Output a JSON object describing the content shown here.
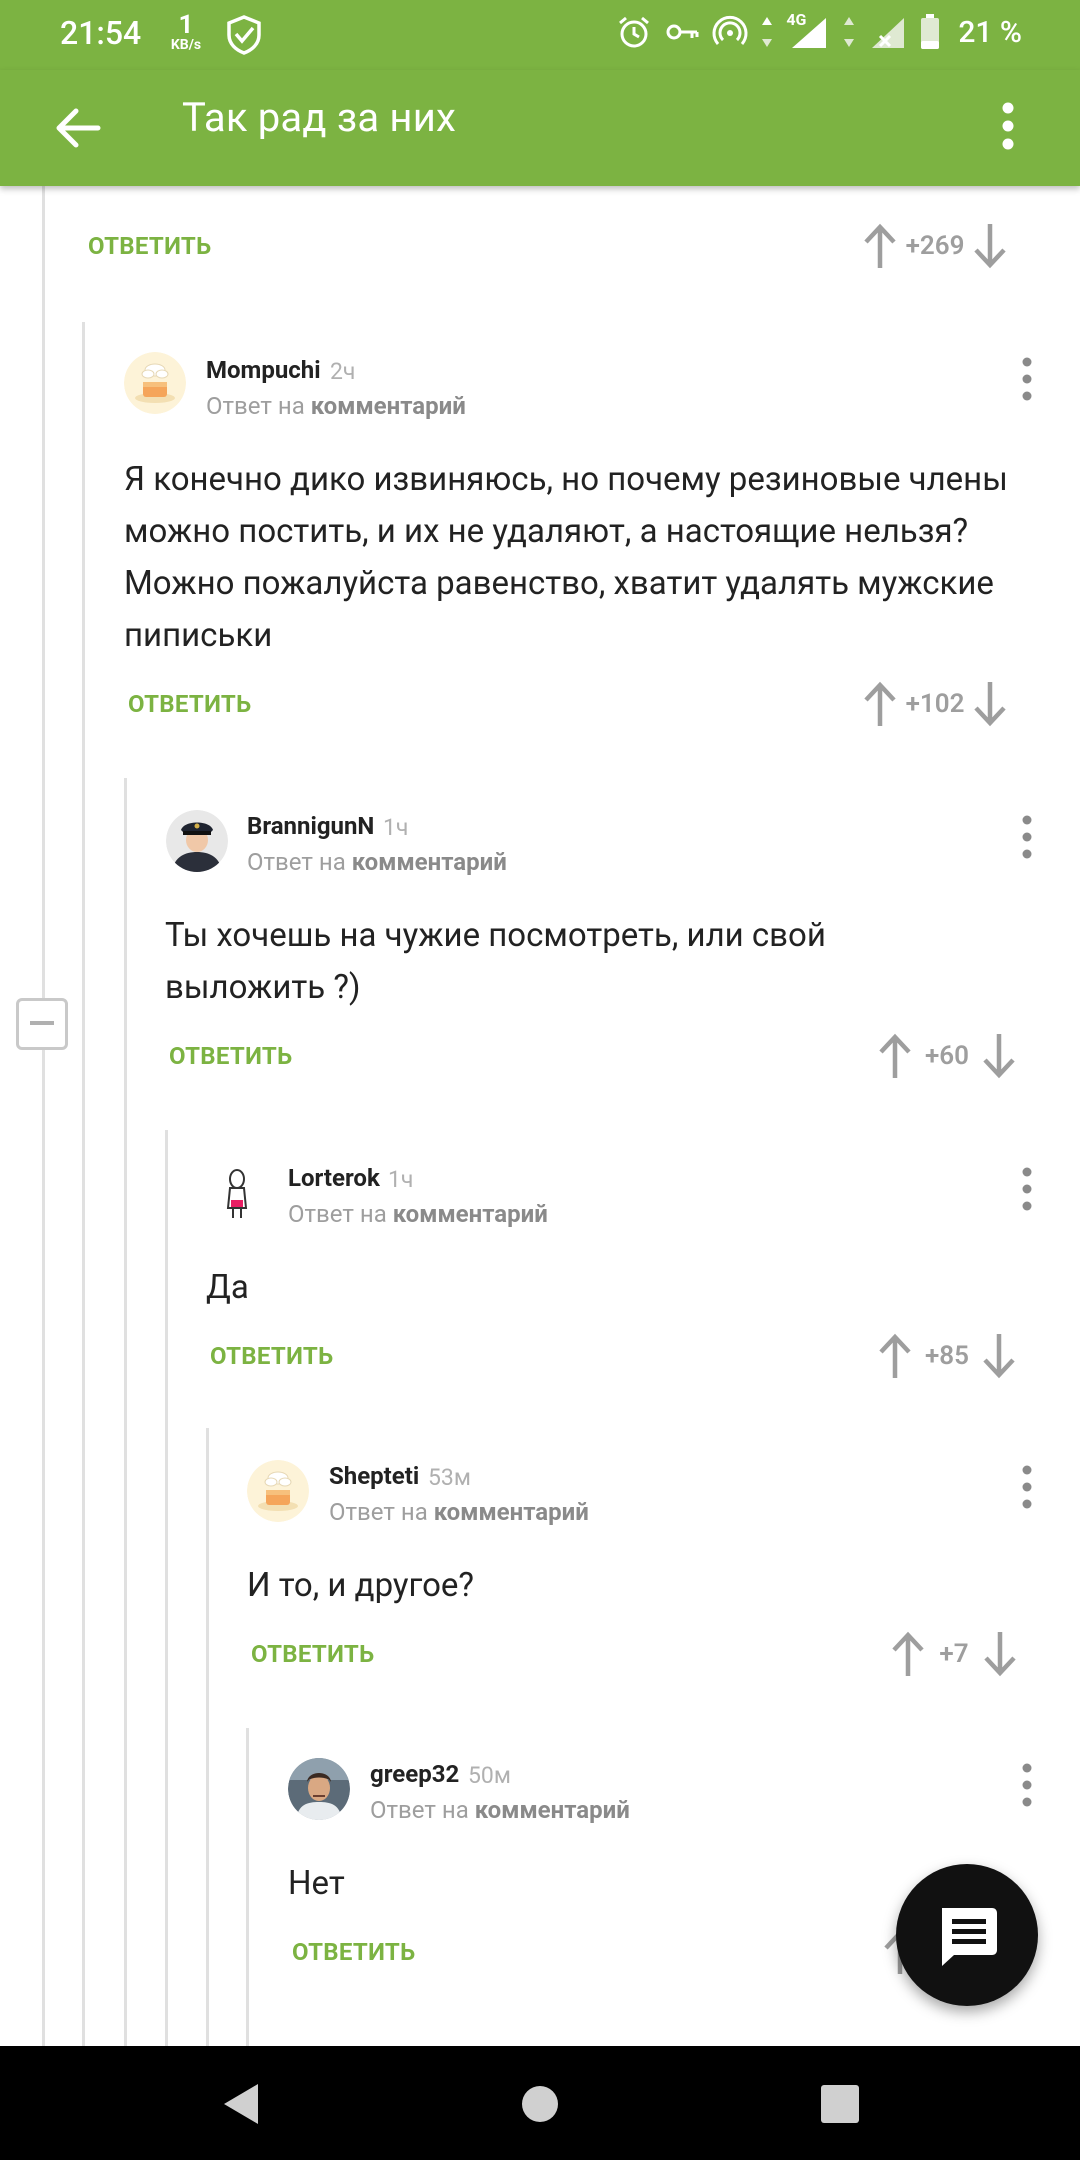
{
  "status": {
    "time": "21:54",
    "speed_value": "1",
    "speed_unit": "KB/s",
    "network": "4G",
    "battery": "21 %"
  },
  "appbar": {
    "title": "Так рад за них"
  },
  "colors": {
    "accent": "#7cb342",
    "score": "#9e9e9e"
  },
  "top_item": {
    "reply_label": "ОТВЕТИТЬ",
    "score": "+269"
  },
  "comments": [
    {
      "author": "Mompuchi",
      "time": "2ч",
      "reply_prefix": "Ответ на",
      "reply_target": "комментарий",
      "text": "Я конечно дико извиняюсь, но почему резиновые члены можно постить, и их не удаляют, а настоящие нельзя? Можно пожалуйста равенство, хватит удалять мужские пиписьки",
      "reply_label": "ОТВЕТИТЬ",
      "score": "+102",
      "avatar": "default-cake-avatar"
    },
    {
      "author": "BrannigunN",
      "time": "1ч",
      "reply_prefix": "Ответ на",
      "reply_target": "комментарий",
      "text": "Ты хочешь на чужие посмотреть, или свой выложить ?)",
      "reply_label": "ОТВЕТИТЬ",
      "score": "+60",
      "avatar": "captain-avatar"
    },
    {
      "author": "Lorterok",
      "time": "1ч",
      "reply_prefix": "Ответ на",
      "reply_target": "комментарий",
      "text": "Да",
      "reply_label": "ОТВЕТИТЬ",
      "score": "+85",
      "avatar": "doodle-avatar"
    },
    {
      "author": "Shepteti",
      "time": "53м",
      "reply_prefix": "Ответ на",
      "reply_target": "комментарий",
      "text": "И то, и другое?",
      "reply_label": "ОТВЕТИТЬ",
      "score": "+7",
      "avatar": "default-cake-avatar"
    },
    {
      "author": "greep32",
      "time": "50м",
      "reply_prefix": "Ответ на",
      "reply_target": "комментарий",
      "text": "Нет",
      "reply_label": "ОТВЕТИТЬ",
      "score": "",
      "avatar": "man-photo-avatar"
    }
  ],
  "icons": {
    "fab": "comment-icon",
    "nav": [
      "back-triangle-icon",
      "home-circle-icon",
      "recents-square-icon"
    ]
  }
}
